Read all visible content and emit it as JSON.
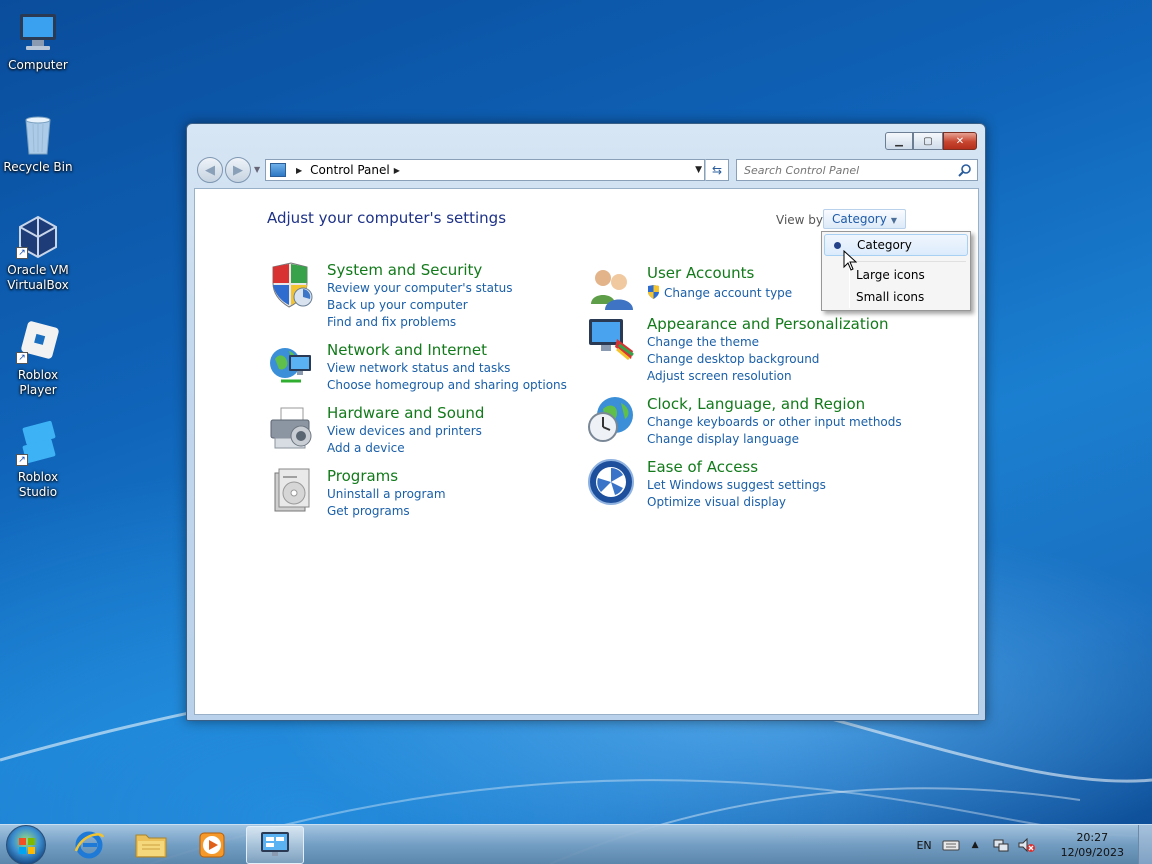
{
  "desktop": {
    "icons": [
      {
        "label": "Computer",
        "icon": "computer-icon"
      },
      {
        "label": "Recycle Bin",
        "icon": "recycle-bin-icon"
      },
      {
        "label": "Oracle VM VirtualBox",
        "icon": "virtualbox-icon"
      },
      {
        "label": "Roblox Player",
        "icon": "roblox-player-icon"
      },
      {
        "label": "Roblox Studio",
        "icon": "roblox-studio-icon"
      }
    ]
  },
  "window": {
    "address": {
      "crumb": "Control Panel"
    },
    "search": {
      "placeholder": "Search Control Panel"
    },
    "page_title": "Adjust your computer's settings",
    "view_by": {
      "label": "View by:",
      "value": "Category"
    },
    "view_menu": {
      "items": [
        "Category",
        "Large icons",
        "Small icons"
      ],
      "selected": "Category"
    },
    "categories": [
      {
        "title": "System and Security",
        "icon": "shield-icon",
        "links": [
          "Review your computer's status",
          "Back up your computer",
          "Find and fix problems"
        ]
      },
      {
        "title": "Network and Internet",
        "icon": "network-globe-icon",
        "links": [
          "View network status and tasks",
          "Choose homegroup and sharing options"
        ]
      },
      {
        "title": "Hardware and Sound",
        "icon": "printer-icon",
        "links": [
          "View devices and printers",
          "Add a device"
        ]
      },
      {
        "title": "Programs",
        "icon": "programs-icon",
        "links": [
          "Uninstall a program",
          "Get programs"
        ]
      },
      {
        "title": "User Accounts",
        "icon": "users-icon",
        "links": [
          "Change account type"
        ]
      },
      {
        "title": "Appearance and Personalization",
        "icon": "monitor-paint-icon",
        "links": [
          "Change the theme",
          "Change desktop background",
          "Adjust screen resolution"
        ]
      },
      {
        "title": "Clock, Language, and Region",
        "icon": "clock-globe-icon",
        "links": [
          "Change keyboards or other input methods",
          "Change display language"
        ]
      },
      {
        "title": "Ease of Access",
        "icon": "ease-of-access-icon",
        "links": [
          "Let Windows suggest settings",
          "Optimize visual display"
        ]
      }
    ]
  },
  "taskbar": {
    "apps": [
      "Internet Explorer",
      "Windows Explorer",
      "Windows Media Player",
      "Control Panel"
    ],
    "active_app": "Control Panel",
    "tray": {
      "language": "EN",
      "time": "20:27",
      "date": "12/09/2023"
    }
  },
  "colors": {
    "category_title": "#127a1a",
    "link": "#1a5fa8",
    "heading": "#1e3287"
  }
}
